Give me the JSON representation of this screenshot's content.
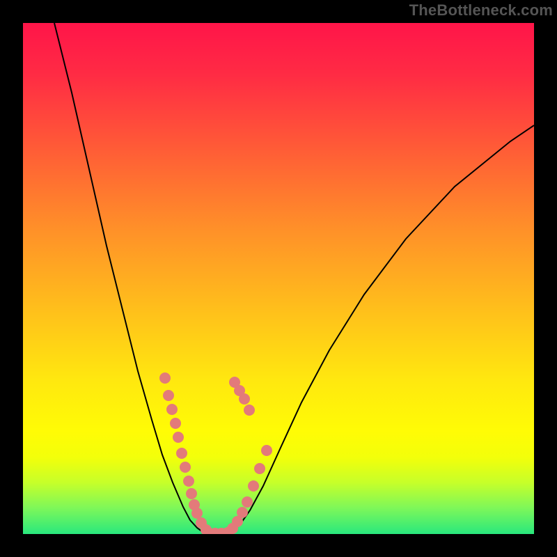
{
  "watermark_text": "TheBottleneck.com",
  "chart_data": {
    "type": "line",
    "title": "",
    "xlabel": "",
    "ylabel": "",
    "x_range": [
      0,
      734
    ],
    "y_range_visual": [
      0,
      734
    ],
    "y_interpretation": "higher y-pixel = lower bottleneck %; curve min (bottom, green) = optimal; top (red) = severe bottleneck",
    "curve_left_points": [
      [
        45,
        0
      ],
      [
        70,
        100
      ],
      [
        95,
        210
      ],
      [
        120,
        320
      ],
      [
        145,
        420
      ],
      [
        165,
        500
      ],
      [
        185,
        570
      ],
      [
        200,
        620
      ],
      [
        215,
        660
      ],
      [
        230,
        695
      ],
      [
        240,
        714
      ],
      [
        250,
        725
      ],
      [
        258,
        731
      ],
      [
        266,
        734
      ]
    ],
    "curve_right_points": [
      [
        266,
        734
      ],
      [
        290,
        734
      ],
      [
        300,
        730
      ],
      [
        312,
        720
      ],
      [
        326,
        700
      ],
      [
        345,
        665
      ],
      [
        370,
        610
      ],
      [
        400,
        545
      ],
      [
        440,
        470
      ],
      [
        490,
        390
      ],
      [
        550,
        310
      ],
      [
        620,
        235
      ],
      [
        700,
        170
      ],
      [
        734,
        147
      ]
    ],
    "series": [
      {
        "name": "sample-markers",
        "points": [
          [
            204,
            510
          ],
          [
            209,
            535
          ],
          [
            214,
            555
          ],
          [
            219,
            575
          ],
          [
            223,
            595
          ],
          [
            228,
            618
          ],
          [
            233,
            638
          ],
          [
            238,
            658
          ],
          [
            242,
            676
          ],
          [
            246,
            692
          ],
          [
            250,
            704
          ],
          [
            256,
            718
          ],
          [
            263,
            728
          ],
          [
            268,
            733
          ],
          [
            276,
            733
          ],
          [
            285,
            733
          ],
          [
            294,
            732
          ],
          [
            301,
            726
          ],
          [
            308,
            716
          ],
          [
            315,
            703
          ],
          [
            322,
            688
          ],
          [
            331,
            665
          ],
          [
            340,
            640
          ],
          [
            350,
            614
          ],
          [
            325,
            556
          ],
          [
            318,
            540
          ],
          [
            311,
            528
          ],
          [
            304,
            516
          ]
        ]
      }
    ]
  }
}
